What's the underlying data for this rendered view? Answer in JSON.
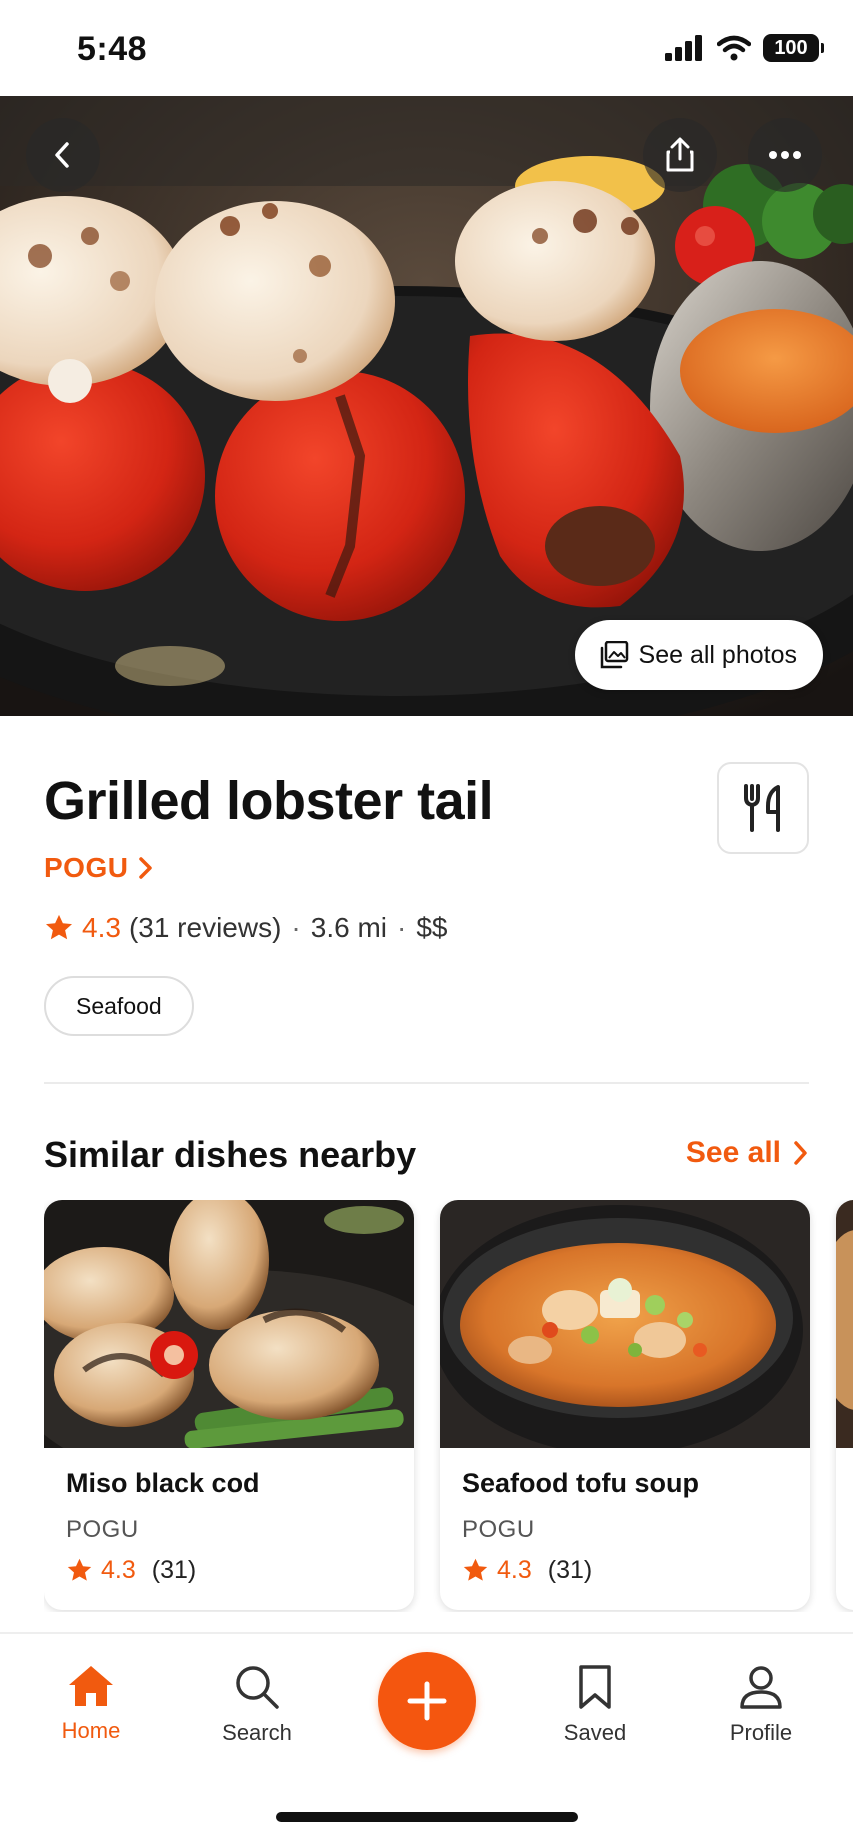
{
  "status_bar": {
    "time": "5:48",
    "battery": "100"
  },
  "hero": {
    "see_all_photos": "See all photos"
  },
  "dish": {
    "title": "Grilled lobster tail",
    "restaurant": "POGU",
    "rating": "4.3",
    "reviews": "(31 reviews)",
    "distance": "3.6 mi",
    "price": "$$",
    "tag": "Seafood"
  },
  "similar": {
    "title": "Similar dishes nearby",
    "see_all": "See all",
    "items": [
      {
        "name": "Miso black cod",
        "restaurant": "POGU",
        "rating": "4.3",
        "count": "(31)"
      },
      {
        "name": "Seafood tofu soup",
        "restaurant": "POGU",
        "rating": "4.3",
        "count": "(31)"
      }
    ]
  },
  "tabs": [
    {
      "label": "Home",
      "icon": "home-icon",
      "active": true
    },
    {
      "label": "Search",
      "icon": "search-icon",
      "active": false
    },
    {
      "label": "Saved",
      "icon": "bookmark-icon",
      "active": false
    },
    {
      "label": "Profile",
      "icon": "person-icon",
      "active": false
    }
  ],
  "colors": {
    "accent": "#f15a0f",
    "fab": "#f4560f"
  }
}
